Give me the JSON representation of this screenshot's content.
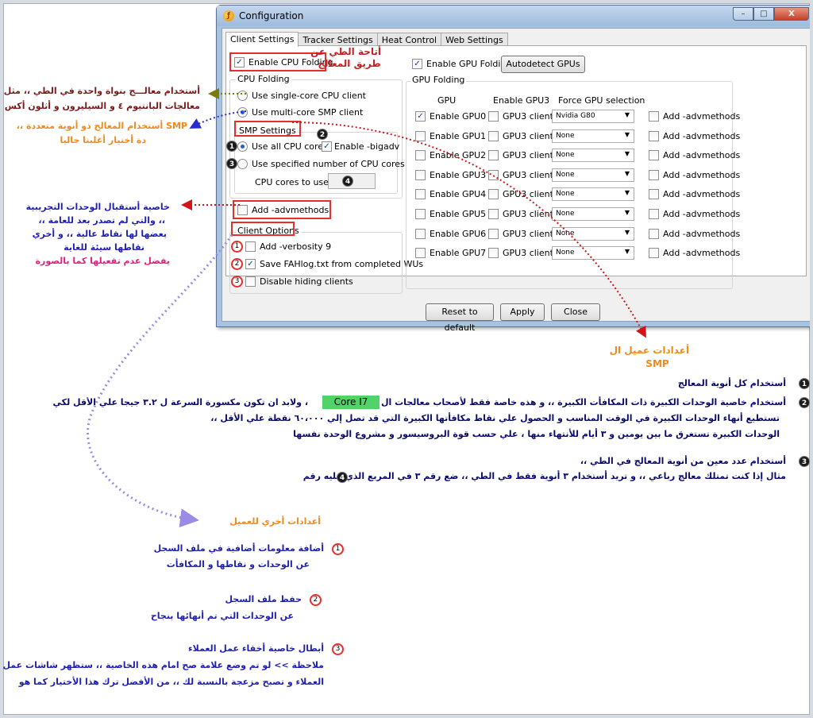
{
  "window": {
    "title": "Configuration",
    "buttons": {
      "minimize": "–",
      "maximize": "□",
      "close": "X"
    },
    "tabs": [
      "Client Settings",
      "Tracker Settings",
      "Heat Control",
      "Web Settings"
    ],
    "active_tab": "Client Settings"
  },
  "client": {
    "enable_cpu_folding": {
      "label": "Enable CPU Folding",
      "checked": true
    },
    "cpu_folding_group": "CPU Folding",
    "single_core": {
      "label": "Use single-core CPU client",
      "selected": false
    },
    "multi_core": {
      "label": "Use multi-core SMP client",
      "selected": true
    },
    "smp_group": "SMP Settings",
    "use_all_cores": {
      "label": "Use all CPU cores",
      "selected": true
    },
    "bigadv": {
      "label": "Enable -bigadv",
      "checked": true
    },
    "specified_cores": {
      "label": "Use specified number of CPU cores",
      "selected": false
    },
    "cores_to_use_label": "CPU cores to use:",
    "advmethods": {
      "label": "Add -advmethods",
      "checked": false
    },
    "options_group": "Client Options",
    "verbosity": {
      "label": "Add -verbosity 9",
      "checked": false
    },
    "save_log": {
      "label": "Save FAHlog.txt from completed WUs",
      "checked": true
    },
    "disable_hiding": {
      "label": "Disable hiding clients",
      "checked": false
    }
  },
  "gpu": {
    "enable_gpu_folding": {
      "label": "Enable GPU Folding",
      "checked": true
    },
    "autodetect_label": "Autodetect GPUs",
    "group": "GPU Folding",
    "headers": [
      "GPU",
      "Enable GPU3",
      "Force GPU selection"
    ],
    "rows": [
      {
        "label": "Enable GPU0",
        "enabled": true,
        "gpu3": "GPU3 client",
        "selection": "Nvidia G80",
        "adv": "Add -advmethods"
      },
      {
        "label": "Enable GPU1",
        "enabled": false,
        "gpu3": "GPU3 client",
        "selection": "None",
        "adv": "Add -advmethods"
      },
      {
        "label": "Enable GPU2",
        "enabled": false,
        "gpu3": "GPU3 client",
        "selection": "None",
        "adv": "Add -advmethods"
      },
      {
        "label": "Enable GPU3",
        "enabled": false,
        "gpu3": "GPU3 client",
        "selection": "None",
        "adv": "Add -advmethods"
      },
      {
        "label": "Enable GPU4",
        "enabled": false,
        "gpu3": "GPU3 client",
        "selection": "None",
        "adv": "Add -advmethods"
      },
      {
        "label": "Enable GPU5",
        "enabled": false,
        "gpu3": "GPU3 client",
        "selection": "None",
        "adv": "Add -advmethods"
      },
      {
        "label": "Enable GPU6",
        "enabled": false,
        "gpu3": "GPU3 client",
        "selection": "None",
        "adv": "Add -advmethods"
      },
      {
        "label": "Enable GPU7",
        "enabled": false,
        "gpu3": "GPU3 client",
        "selection": "None",
        "adv": "Add -advmethods"
      }
    ]
  },
  "footer": {
    "reset": "Reset to default",
    "apply": "Apply",
    "close": "Close"
  },
  "annotations": {
    "cpu_folding": "أتاحة الطي عن\nطريق المعالج",
    "single_core_line1": "أستخدام   معالـــج   بنواة واحدة في الطي ،، مثل",
    "single_core_line2": "معالجات البانتيوم ٤ و السيليرون و أثلون أكس بي",
    "smp_line1": "SMP  أستخدام المعالج ذو أنوية متعددة  ،،",
    "smp_line2": "دة أختيار أغلبنا حاليا",
    "adv_line1": "خاصية أستقبال الوحدات التجريبية",
    "adv_line2": "،، والتي لم تصدر بعد للعامة ،،",
    "adv_line3": "بعضها لها نقاط عالية ،، و أخري",
    "adv_line4": "نقاطها سيئة للغاية",
    "adv_line5": "يفضل عدم تفعيلها كما بالصورة",
    "smp_settings_caption_1": "أعدادات عميل ال",
    "smp_settings_caption_2": "SMP",
    "note1": "أستخدام كل أنوية المعالج",
    "note2_part_a": "أستخدام خاصية الوحدات الكبيرة ذات المكافأت الكبيرة ،،   و هذه خاصة فقط لأصحاب معالجات ال",
    "note2_core": "Core I7",
    "note2_part_b": "،  ولابد ان تكون مكسورة السرعة ل ٣.٢ جيجا علي الأقل لكي",
    "note2_line2": "تستطيع أنهاء الوحدات الكبيرة في الوقت المناسب و الحصول علي نقاط مكافأتها الكبيرة التي قد تصل إلي ٦٠،٠٠٠ نقطة علي الأقل ،،",
    "note2_line3": "الوحدات الكبيرة تستغرق ما بين يومين و ٣ أيام للأنتهاء منها ،   علي حسب قوة البروسيسور و مشروع الوحدة نفسها",
    "note3_line1": "أستخدام عدد معين من أنوية المعالج في الطي ،،",
    "note3_line2": "مثال إذا كنت تمتلك معالج رباعي ،،   و تريد أستخدام ٣ أنوية فقط في الطي ،،  ضع رقم ٣ في المربع الذي عليه رقم",
    "other_settings": "أعدادات أخري للعميل",
    "opt1_line1": "أضافة معلومات أضافية في ملف السجل",
    "opt1_line2": "عن الوحدات و نقاطها و المكافأت",
    "opt2_line1": "حفظ ملف السجل",
    "opt2_line2": "عن الوحدات التي تم أنهائها بنجاح",
    "opt3_line1": "أبطال خاصية أخفاء عمل العملاء",
    "opt3_line2": "ملاحظة >>  لو تم وضع علامة صح امام هذه الخاصية ،،   ستظهر شاشات عمل",
    "opt3_line3": "العملاء و تصبح مزعجة بالنسبة لك ،،  من الأفضل ترك هذا الأختيار كما هو"
  }
}
